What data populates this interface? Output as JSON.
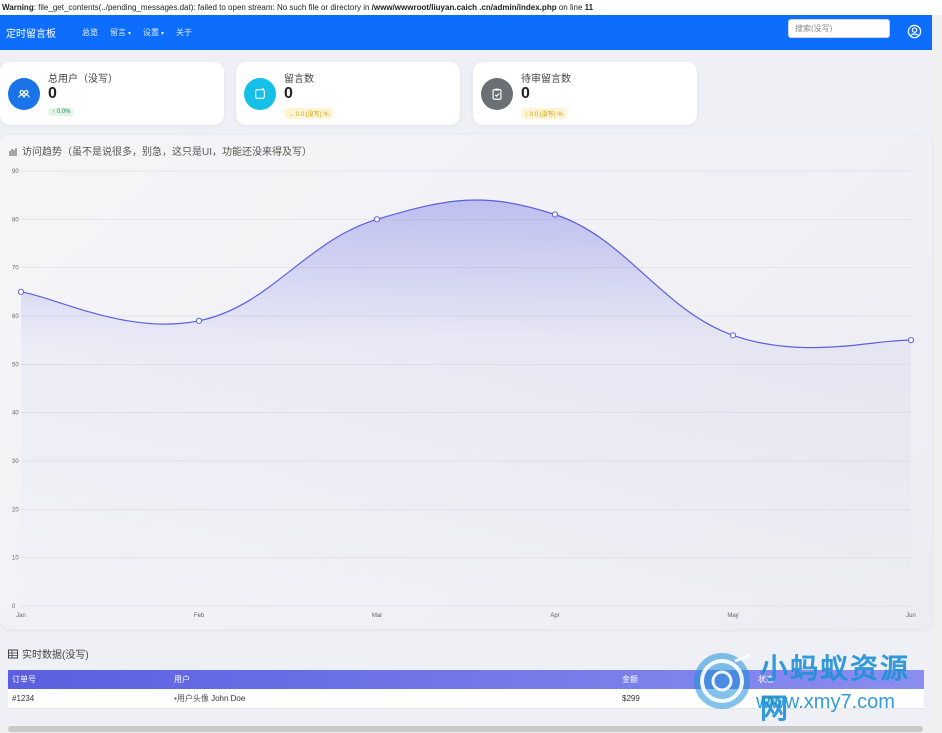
{
  "warning": {
    "label": "Warning",
    "message": ": file_get_contents(../pending_messages.dat): failed to open stream: No such file or directory in ",
    "path": "/www/wwwroot/liuyan.caich     .cn/admin/index.php",
    "on_line": " on line ",
    "line": "11"
  },
  "navbar": {
    "brand": "定时留言板",
    "links": [
      {
        "label": "总览",
        "active": true,
        "dropdown": false
      },
      {
        "label": "留言",
        "active": false,
        "dropdown": true
      },
      {
        "label": "设置",
        "active": false,
        "dropdown": true
      },
      {
        "label": "关于",
        "active": false,
        "dropdown": false
      }
    ],
    "search_placeholder": "搜索(没写)",
    "user_icon": "user-circle-icon"
  },
  "cards": [
    {
      "title": "总用户（没写）",
      "value": "0",
      "badge": "↑ 0.0%",
      "icon": "users-icon",
      "color": "#1a73e8",
      "badge_bg": "#e3f5ea",
      "badge_color": "#198754"
    },
    {
      "title": "留言数",
      "value": "0",
      "badge": "→ 0.0 (没写) %",
      "icon": "message-refresh-icon",
      "color": "#14c0e8",
      "badge_bg": "#fff5d6",
      "badge_color": "#c99a00"
    },
    {
      "title": "待审留言数",
      "value": "0",
      "badge": "↓ 0.0 (没写) %",
      "icon": "clipboard-check-icon",
      "color": "#6c6f73",
      "badge_bg": "#fff5d6",
      "badge_color": "#c99a00"
    }
  ],
  "chart": {
    "title": "访问趋势（虽不是说很多，别急，这只是UI，功能还没来得及写）",
    "icon": "bar-chart-icon"
  },
  "chart_data": {
    "type": "area",
    "categories": [
      "Jan",
      "Feb",
      "Mar",
      "Apr",
      "May",
      "Jun"
    ],
    "values": [
      65,
      59,
      80,
      81,
      56,
      55
    ],
    "ylim": [
      0,
      90
    ],
    "yticks": [
      0,
      10,
      20,
      30,
      40,
      50,
      60,
      70,
      80,
      90
    ],
    "line_color": "#5b5fe0",
    "grid": true,
    "legend": "none"
  },
  "table": {
    "title": "实时数据(没写)",
    "icon": "table-icon",
    "columns": [
      "订单号",
      "用户",
      "金额",
      "状态"
    ],
    "rows": [
      {
        "order": "#1234",
        "avatar_alt": "用户头像",
        "user": "John Doe",
        "amount": "$299",
        "status": "已完成"
      }
    ]
  },
  "watermark": {
    "cn": "小蚂蚁资源网",
    "url": "www.xmy7.com"
  }
}
